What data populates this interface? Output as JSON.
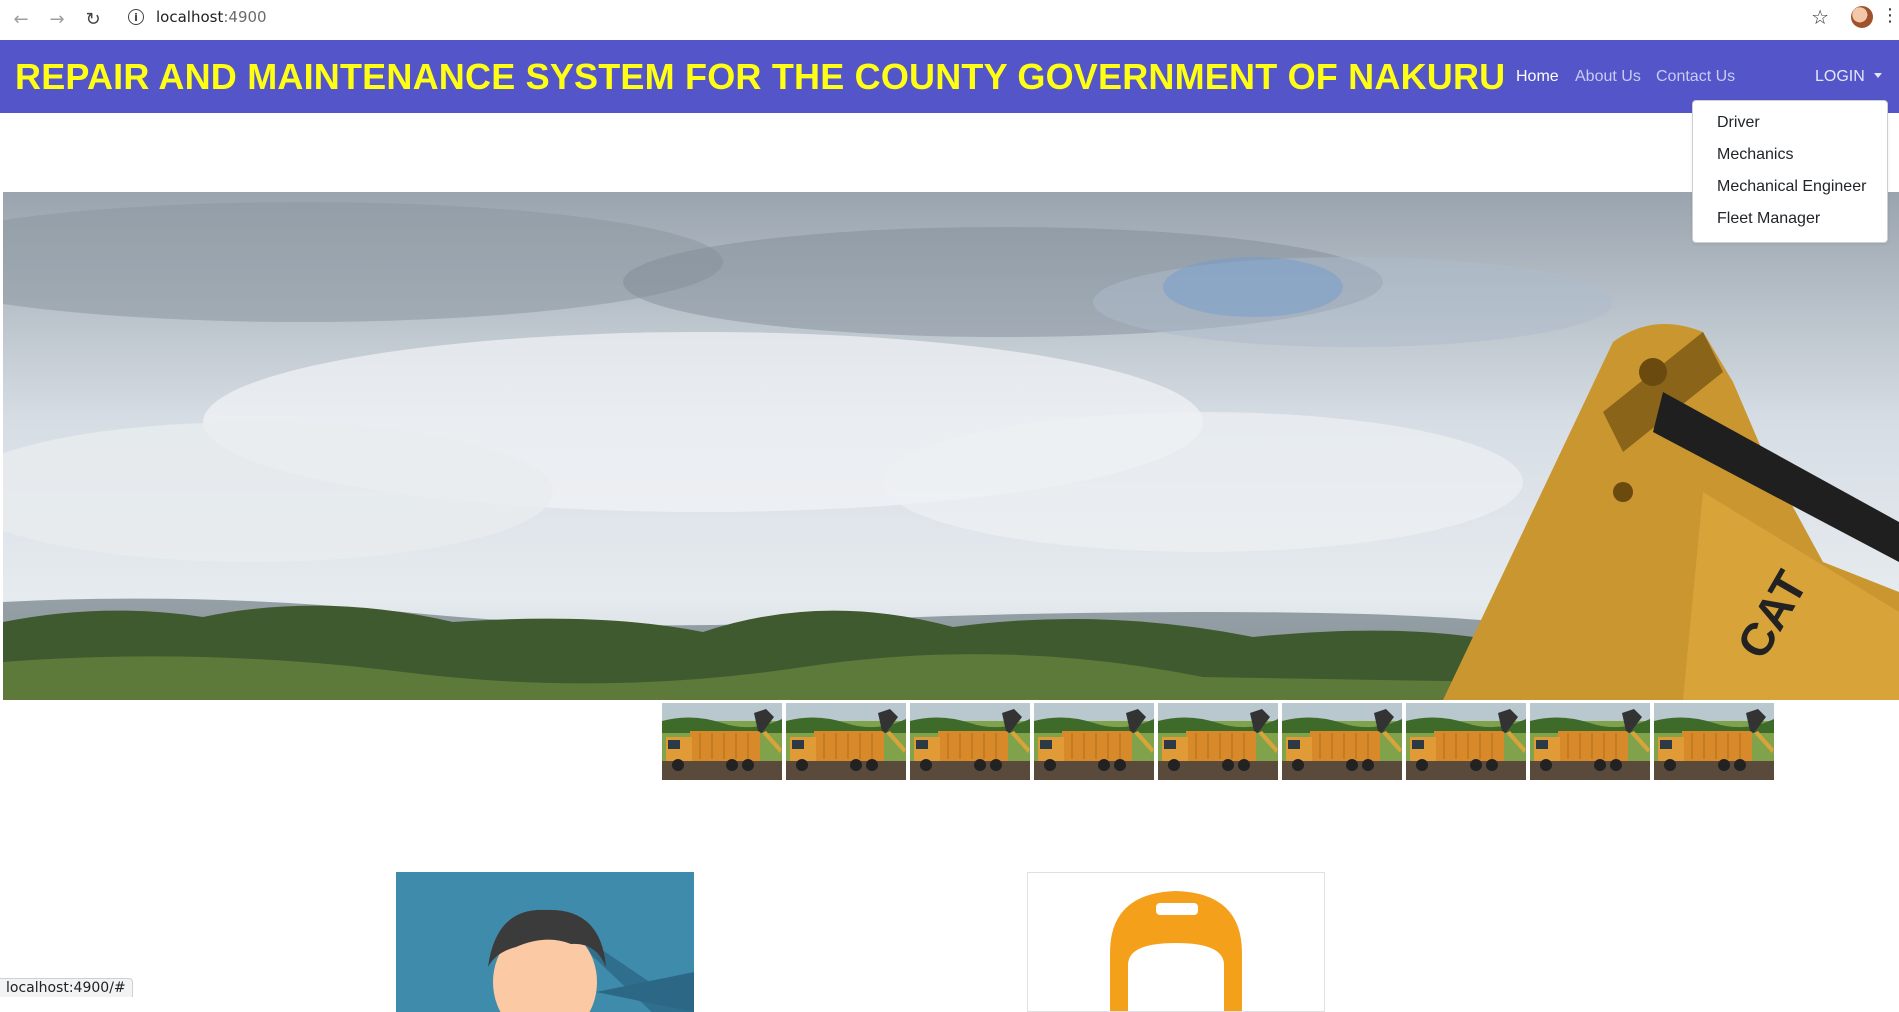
{
  "browser": {
    "url_host": "localhost",
    "url_port": ":4900",
    "status_url": "localhost:4900/#",
    "icons": [
      "back-icon",
      "forward-icon",
      "reload-icon",
      "site-info-icon",
      "bookmark-star-icon",
      "profile-avatar",
      "browser-menu-icon"
    ]
  },
  "navbar": {
    "brand": "REPAIR AND MAINTENANCE SYSTEM FOR THE COUNTY GOVERNMENT OF NAKURU",
    "links": [
      {
        "label": "Home",
        "active": true
      },
      {
        "label": "About Us",
        "active": false
      },
      {
        "label": "Contact Us",
        "active": false
      }
    ],
    "login_label": "LOGIN",
    "colors": {
      "background": "#5355c9",
      "brand_text": "#ffff14"
    }
  },
  "login_menu": {
    "items": [
      "Driver",
      "Mechanics",
      "Mechanical Engineer",
      "Fleet Manager"
    ]
  },
  "hero": {
    "image": "excavator-landscape-photo"
  },
  "thumbnails": {
    "image": "dump-truck-photo",
    "count": 9
  },
  "cards": [
    {
      "image": "male-user-avatar-illustration"
    },
    {
      "image": "hard-hat-worker-avatar-illustration"
    }
  ]
}
